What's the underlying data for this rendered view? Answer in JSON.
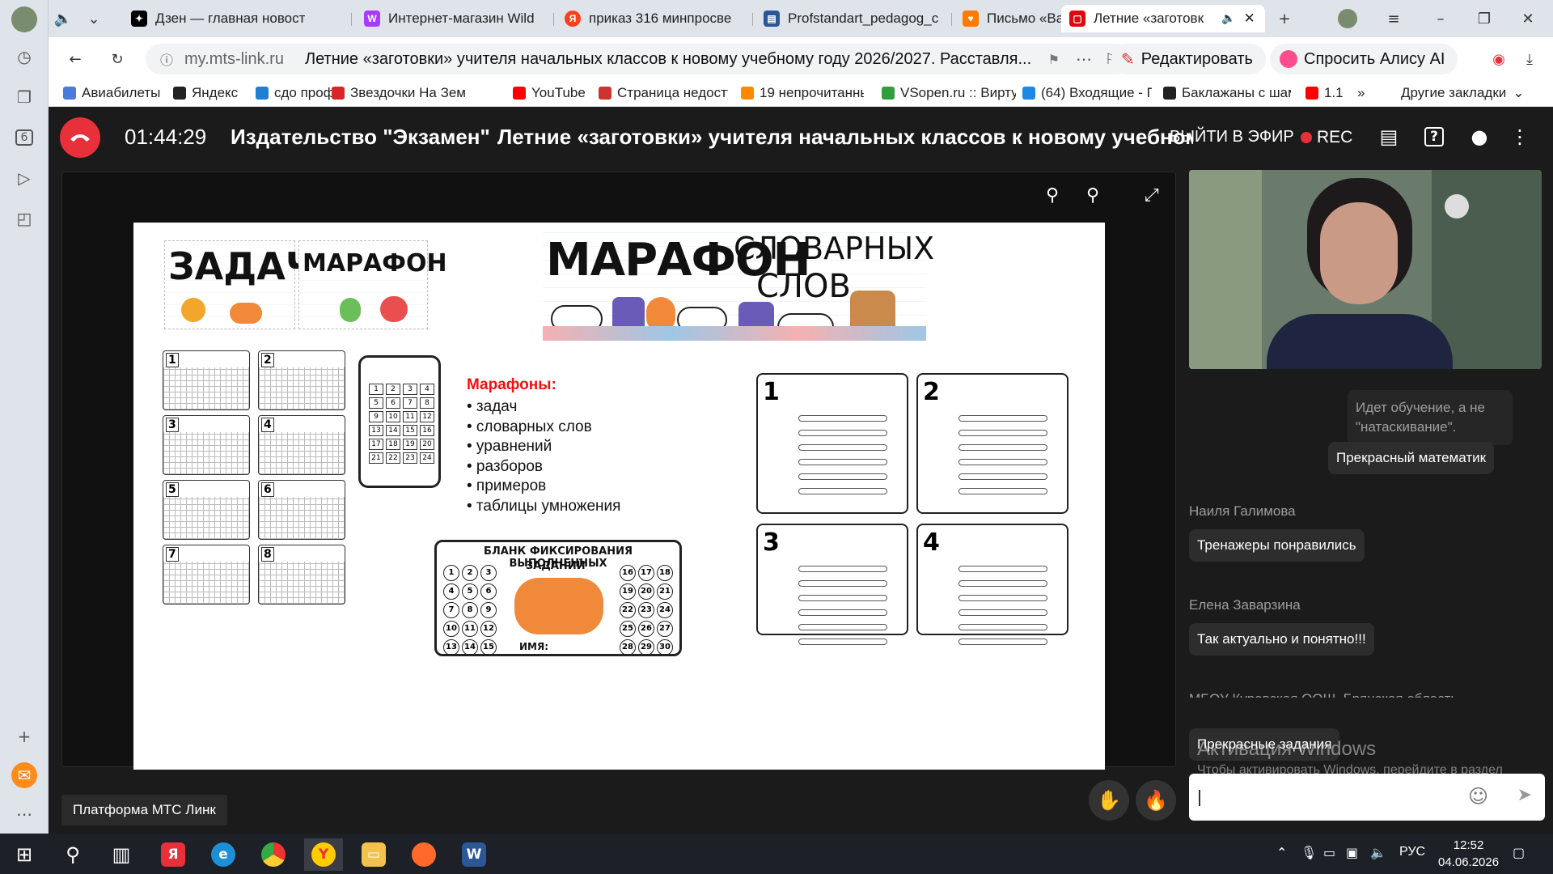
{
  "browser": {
    "tabs": [
      {
        "title": "Дзен — главная новост",
        "favicon": "dzen-icon",
        "color": "#000000"
      },
      {
        "title": "Интернет-магазин Wild",
        "favicon": "wildberries-icon",
        "color": "#a73afd"
      },
      {
        "title": "приказ 316 минпросве",
        "favicon": "yandex-icon",
        "color": "#fc3f1d"
      },
      {
        "title": "Profstandart_pedagog_c",
        "favicon": "word-doc-icon",
        "color": "#2b5797"
      },
      {
        "title": "Письмо «Ваш подарок",
        "favicon": "mail-icon",
        "color": "#ff7a00"
      },
      {
        "title": "Летние «заготовк",
        "favicon": "mts-link-icon",
        "color": "#e30611",
        "active": true
      }
    ],
    "address": {
      "host": "my.mts-link.ru",
      "title": "Летние «заготовки» учителя начальных классов к новому учебному году 2026/2027. Расставля..."
    },
    "edit_label": "Редактировать",
    "alice_label": "Спросить Алису AI",
    "bookmarks": [
      {
        "label": "Авиабилеты",
        "color": "#4a7bd9"
      },
      {
        "label": "Яндекс",
        "color": "#222222"
      },
      {
        "label": "сдо проф",
        "color": "#1f7fd0"
      },
      {
        "label": "Звездочки На Зем",
        "color": "#d9252a"
      },
      {
        "label": "YouTube",
        "color": "#ff0000"
      },
      {
        "label": "Страница недосту",
        "color": "#cc3333"
      },
      {
        "label": "19 непрочитанны",
        "color": "#ff8800"
      },
      {
        "label": "VSopen.ru :: Вирту",
        "color": "#2e9e3e"
      },
      {
        "label": "(64) Входящие - П",
        "color": "#1e88e5"
      },
      {
        "label": "Баклажаны с шам",
        "color": "#222222"
      },
      {
        "label": "1.1",
        "color": "#ff0000"
      }
    ],
    "other_bookmarks": "Другие закладки",
    "more_bookmarks": "»"
  },
  "sidebar": {
    "tab_count": "6"
  },
  "webinar": {
    "timer": "01:44:29",
    "organizer": "Издательство \"Экзамен\"",
    "title": "Летние «заготовки» учителя начальных классов к новому учебному году",
    "go_live": "ВЫЙТИ В ЭФИР",
    "rec": "REC",
    "platform": "Платформа МТС Линк",
    "colors": {
      "accent": "#e8303a",
      "bg": "#1b1b1b"
    }
  },
  "slide": {
    "tl_word1": "ЗАДАЧ",
    "tl_word2": "МАРАФОН",
    "tr_word1": "МАРАФОН",
    "tr_word2": "СЛОВАРНЫХ",
    "tr_word3": "СЛОВ",
    "list_title": "Марафоны:",
    "list": [
      "задач",
      "словарных слов",
      "уравнений",
      "разборов",
      "примеров",
      "таблицы умножения"
    ],
    "blank_title": "БЛАНК ФИКСИРОВАНИЯ ВЫПОЛНЕННЫХ",
    "blank_sub": "ЗАДАНИЙ",
    "blank_name": "ИМЯ:",
    "task_nums": [
      "1",
      "2",
      "3",
      "4",
      "5",
      "6",
      "7",
      "8"
    ],
    "card_nums": [
      "1",
      "2",
      "3",
      "4"
    ]
  },
  "chat": {
    "messages": [
      {
        "author": "",
        "text": "Идет обучение, а не \"натаскивание\"."
      },
      {
        "author": "",
        "text": "Прекрасный математик"
      },
      {
        "author": "Наиля Галимова",
        "text": "Тренажеры понравились"
      },
      {
        "author": "Елена Заварзина",
        "text": "Так актуально и понятно!!!"
      },
      {
        "author": "МБОУ Куровская ООШ. Брянская область",
        "text": "Прекрасные задания"
      }
    ]
  },
  "watermark": {
    "line1": "Активация Windows",
    "line2": "Чтобы активировать Windows, перейдите в раздел \"Параметры\"."
  },
  "taskbar": {
    "lang": "РУС",
    "time": "12:52",
    "date": "04.06.2026"
  }
}
